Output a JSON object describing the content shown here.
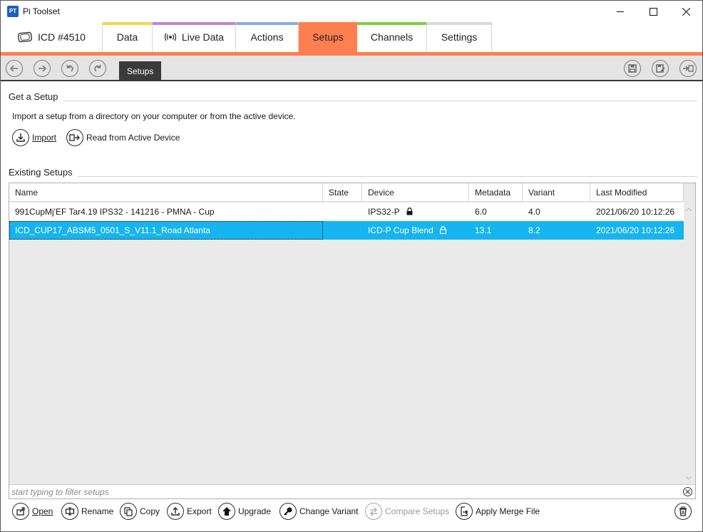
{
  "app": {
    "title": "Pi Toolset",
    "icon": "app-logo-icon",
    "icon_letters": "PT"
  },
  "window_controls": [
    "minimize-icon",
    "maximize-icon",
    "close-icon"
  ],
  "tabs": [
    {
      "label": "ICD #4510",
      "icon": "device-icon",
      "accent": "#ffffff"
    },
    {
      "label": "Data",
      "accent": "#f0d84a"
    },
    {
      "label": "Live Data",
      "icon": "broadcast-icon",
      "accent": "#c77fd8"
    },
    {
      "label": "Actions",
      "accent": "#84aee0"
    },
    {
      "label": "Setups",
      "accent": "#ff7f50",
      "active": true
    },
    {
      "label": "Channels",
      "accent": "#7ccf3c"
    },
    {
      "label": "Settings",
      "accent": "#d8d8d8"
    }
  ],
  "toolbar": {
    "breadcrumb": "Setups",
    "left_buttons": [
      "back-icon",
      "forward-icon",
      "undo-icon",
      "redo-icon"
    ],
    "right_buttons": [
      "save-icon",
      "save-as-icon",
      "exit-icon"
    ]
  },
  "get_setup": {
    "title": "Get a Setup",
    "description": "Import a setup from a directory on your computer or from the active device.",
    "import_label": "Import",
    "read_device_label": "Read from Active Device"
  },
  "existing": {
    "title": "Existing Setups",
    "columns": [
      "Name",
      "State",
      "Device",
      "Metadata",
      "Variant",
      "Last Modified"
    ],
    "rows": [
      {
        "name": "991CupMj'EF Tar4.19 IPS32 - 141216 - PMNA - Cup",
        "state": "",
        "device": "IPS32-P",
        "locked": true,
        "metadata": "6.0",
        "variant": "4.0",
        "modified": "2021/06/20 10:12:26",
        "selected": false
      },
      {
        "name": "ICD_CUP17_ABSM5_0501_S_V11.1_Road Atlanta",
        "state": "",
        "device": "ICD-P Cup Blend",
        "locked": true,
        "metadata": "13.1",
        "variant": "8.2",
        "modified": "2021/06/20 10:12:26",
        "selected": true
      }
    ],
    "filter_placeholder": "start typing to filter setups"
  },
  "bottom_actions": {
    "open": "Open",
    "rename": "Rename",
    "copy": "Copy",
    "export": "Export",
    "upgrade": "Upgrade",
    "change_variant": "Change Variant",
    "compare": "Compare Setups",
    "apply_merge": "Apply Merge File"
  },
  "colors": {
    "accent_orange": "#ff7f50",
    "selection": "#16b4f0",
    "toolbar_bg": "#e4e4e4"
  }
}
